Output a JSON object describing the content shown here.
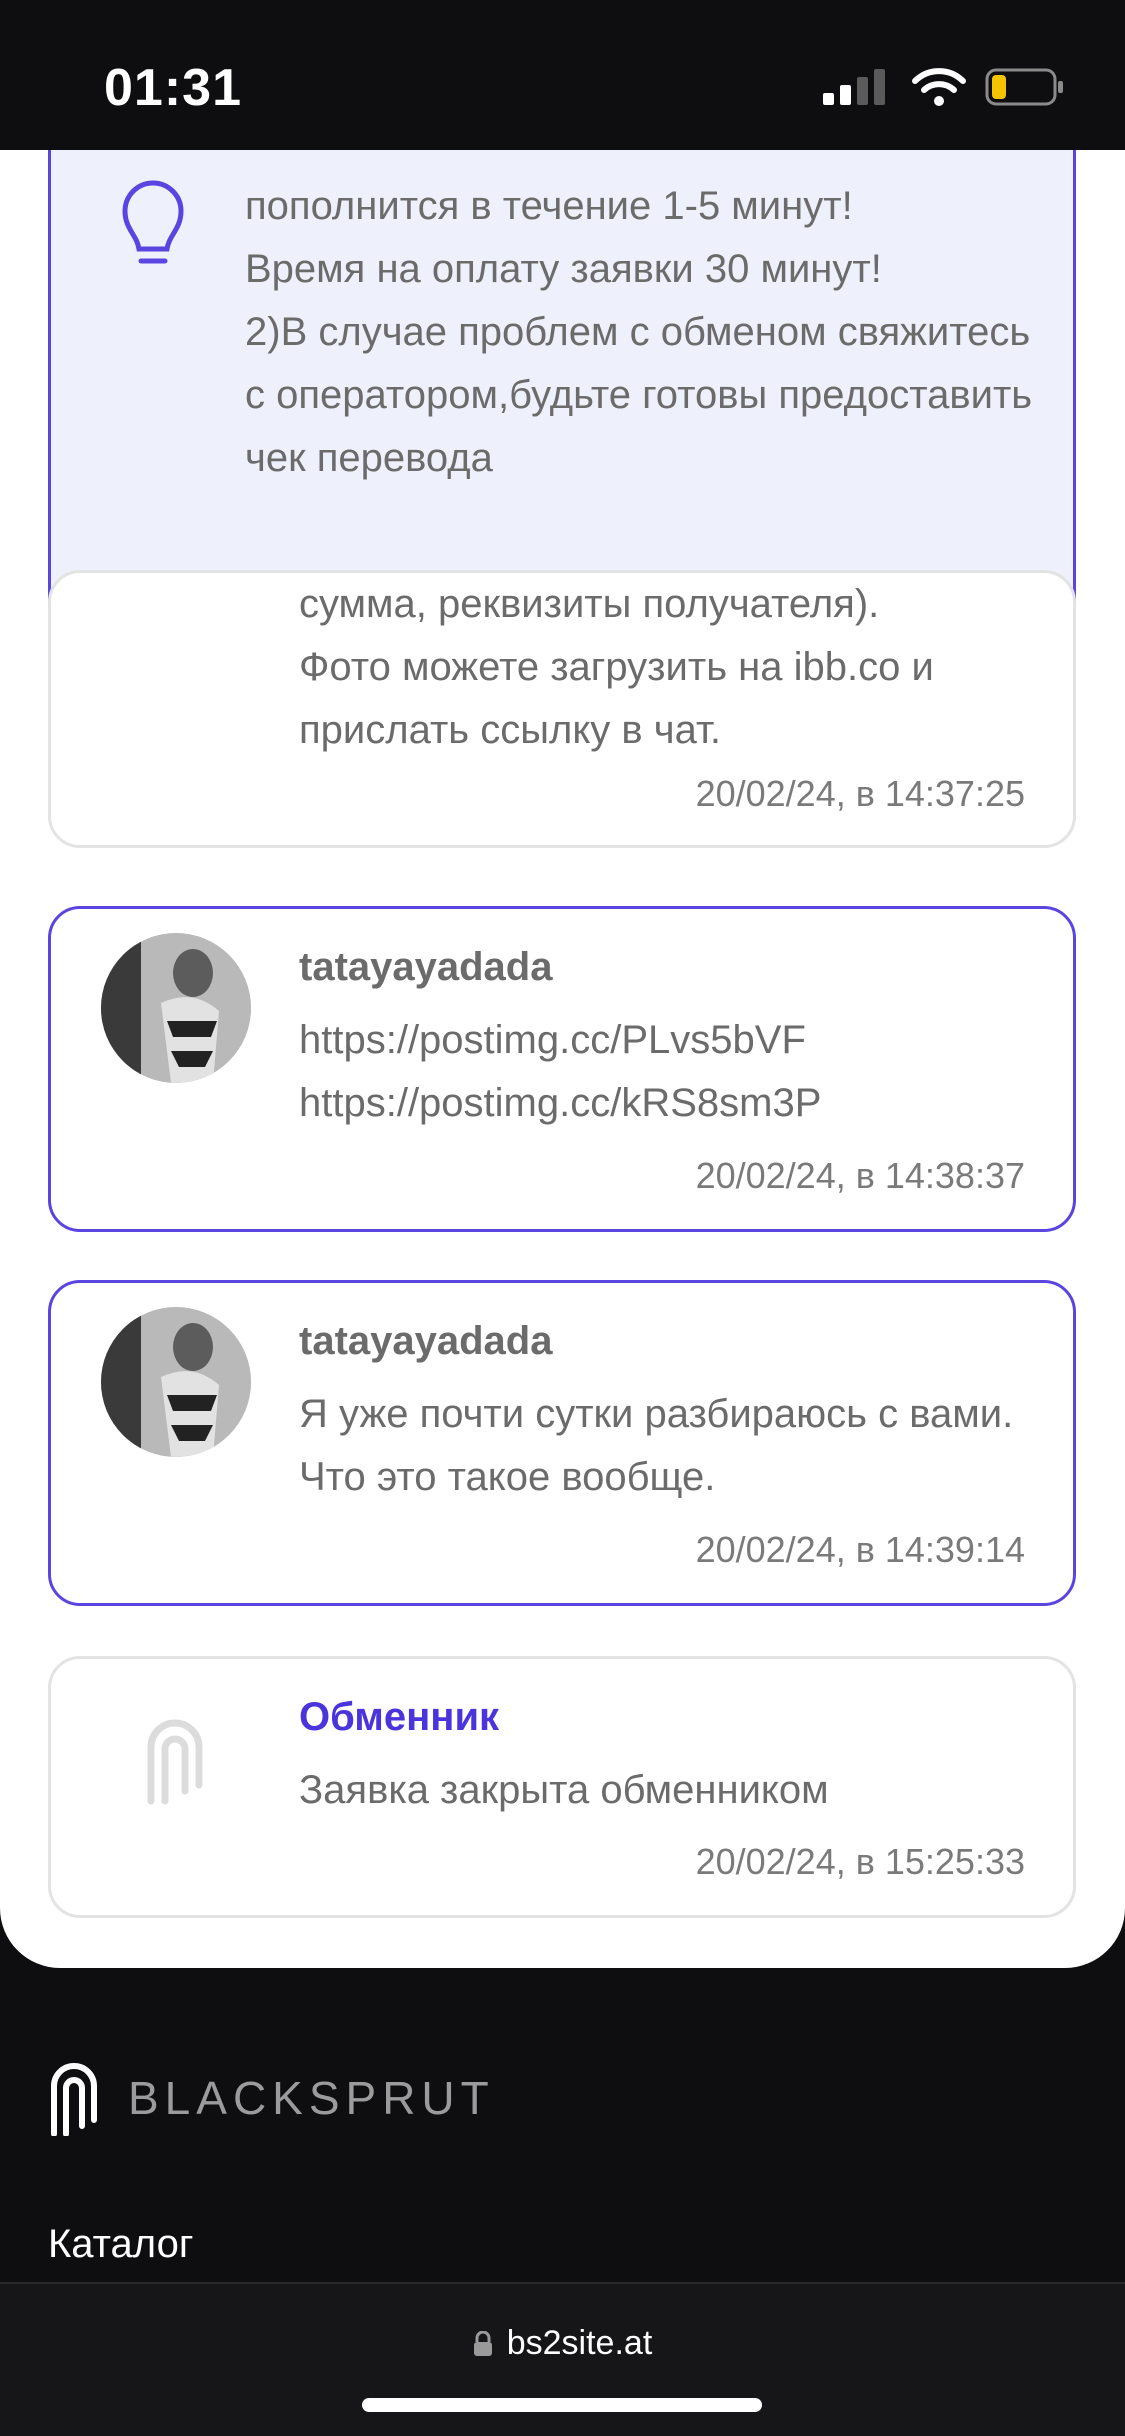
{
  "status_bar": {
    "time": "01:31"
  },
  "info_box": {
    "text": "пополнится в течение 1-5 минут!\nВремя на оплату заявки 30 минут!\n2)В случае проблем с обменом свяжитесь с оператором,будьте готовы предоставить чек перевода"
  },
  "messages": [
    {
      "body": "сумма, реквизиты получателя).\nФото можете загрузить на ibb.co и прислать ссылку в чат.",
      "time": "20/02/24, в 14:37:25"
    },
    {
      "author": "tatayayadada",
      "body": "https://postimg.cc/PLvs5bVF\nhttps://postimg.cc/kRS8sm3P",
      "time": "20/02/24, в 14:38:37"
    },
    {
      "author": "tatayayadada",
      "body": "Я уже почти сутки разбираюсь с вами. Что это такое вообще.",
      "time": "20/02/24, в 14:39:14"
    },
    {
      "author": "Обменник",
      "body": "Заявка закрыта обменником",
      "time": "20/02/24, в 15:25:33"
    }
  ],
  "footer": {
    "brand": "BLACKSPRUT",
    "link_catalog": "Каталог"
  },
  "browser": {
    "url": "bs2site.at"
  },
  "colors": {
    "accent": "#5a45e0",
    "brand_text": "#4a34dc"
  }
}
